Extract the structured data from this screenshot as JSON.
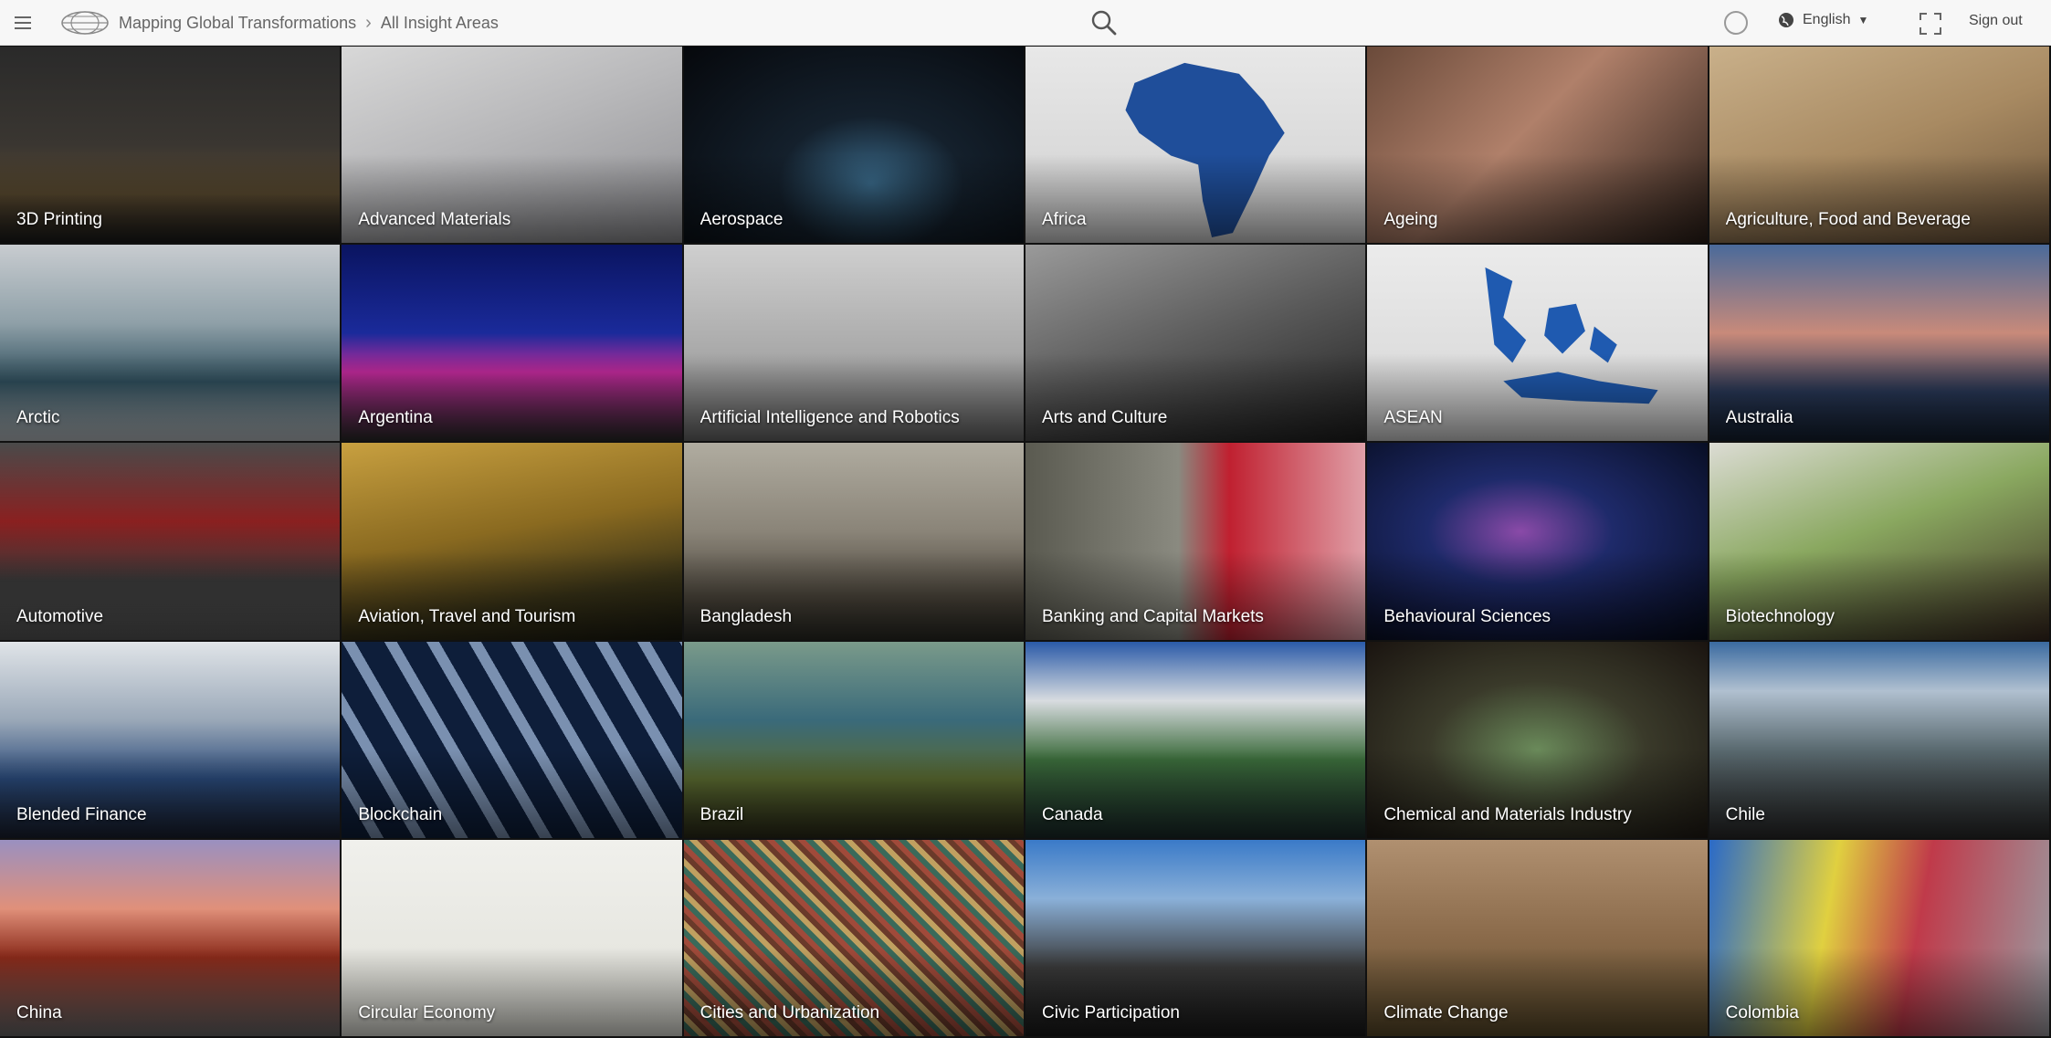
{
  "header": {
    "breadcrumb_root": "Mapping Global Transformations",
    "breadcrumb_separator": "›",
    "breadcrumb_current": "All Insight Areas",
    "language": "English",
    "sign_out": "Sign out"
  },
  "tiles": [
    {
      "label": "3D Printing",
      "bg": "linear-gradient(180deg,#2a2a2a 0%,#3a3631 50%,#5a4a30 75%,#1a1a1a 100%)"
    },
    {
      "label": "Advanced Materials",
      "bg": "linear-gradient(160deg,#d8d8d8 0%,#b8b8ba 45%,#8c8c90 100%)"
    },
    {
      "label": "Aerospace",
      "bg": "radial-gradient(ellipse at 55% 70%,#3a6a8a 0%,#14202c 35%,#06080c 100%)"
    },
    {
      "label": "Africa",
      "bg": "linear-gradient(180deg,#e8e8e8 0%,#cfcfcf 100%)"
    },
    {
      "label": "Ageing",
      "bg": "linear-gradient(135deg,#6a4a3a 0%,#b0806a 45%,#2a1e18 100%)"
    },
    {
      "label": "Agriculture, Food and Beverage",
      "bg": "linear-gradient(160deg,#c9b08a 0%,#a88a62 50%,#6a5238 100%)"
    },
    {
      "label": "Arctic",
      "bg": "linear-gradient(180deg,#c8ccd0 0%,#8fa0a8 40%,#30505e 70%,#c0c6ca 100%)"
    },
    {
      "label": "Argentina",
      "bg": "linear-gradient(180deg,#0a1460 0%,#1a2a9a 45%,#c02a9a 65%,#2a2a2a 100%)"
    },
    {
      "label": "Artificial Intelligence and Robotics",
      "bg": "linear-gradient(180deg,#cfcfcf 0%,#a6a6a6 60%,#6a6a6a 100%)"
    },
    {
      "label": "Arts and Culture",
      "bg": "linear-gradient(160deg,#9a9a9a 0%,#5a5a5a 50%,#1e1e1e 100%)"
    },
    {
      "label": "ASEAN",
      "bg": "linear-gradient(180deg,#ebebeb 0%,#d4d4d4 100%)"
    },
    {
      "label": "Australia",
      "bg": "linear-gradient(180deg,#4a6a9a 0%,#c88a7a 45%,#2a3a5a 75%,#142030 100%)"
    },
    {
      "label": "Automotive",
      "bg": "linear-gradient(180deg,#4a4a4a 0%,#8a2020 40%,#3a3a3a 70%,#5a5a5a 100%)"
    },
    {
      "label": "Aviation, Travel and Tourism",
      "bg": "linear-gradient(170deg,#c8a040 0%,#8a6a20 45%,#3a3418 75%,#1a1a10 100%)"
    },
    {
      "label": "Bangladesh",
      "bg": "linear-gradient(180deg,#b0aca0 0%,#8a8478 45%,#4a443a 80%,#2a2a24 100%)"
    },
    {
      "label": "Banking and Capital Markets",
      "bg": "linear-gradient(90deg,#5a5a50 0%,#8a8a80 45%,#c02030 60%,#e0a0a8 100%)"
    },
    {
      "label": "Behavioural Sciences",
      "bg": "radial-gradient(ellipse at 45% 45%,#8a4aa8 0%,#1e2a6a 35%,#050a1a 100%)"
    },
    {
      "label": "Biotechnology",
      "bg": "linear-gradient(160deg,#dcdcd4 0%,#8aa860 45%,#3a2a20 100%)"
    },
    {
      "label": "Blended Finance",
      "bg": "linear-gradient(180deg,#e0e4e8 0%,#9aa8b8 40%,#2a4a7a 70%,#1a2030 100%)"
    },
    {
      "label": "Blockchain",
      "bg": "repeating-linear-gradient(60deg,#0e1e3a 0px,#0e1e3a 28px,#7a90b0 28px,#7a90b0 40px)"
    },
    {
      "label": "Brazil",
      "bg": "linear-gradient(180deg,#7a9a8a 0%,#3a6a7a 40%,#5a6a30 70%,#2a2a18 100%)"
    },
    {
      "label": "Canada",
      "bg": "linear-gradient(180deg,#2a5aa8 0%,#d8dce0 30%,#3a6a3a 60%,#1a2a2a 100%)"
    },
    {
      "label": "Chemical and Materials Industry",
      "bg": "radial-gradient(ellipse at 50% 55%,#6a8a5a 0%,#3a3a2a 45%,#1a1410 100%)"
    },
    {
      "label": "Chile",
      "bg": "linear-gradient(180deg,#3a6aa0 0%,#b0c0d0 25%,#5a6a70 55%,#2a2a2a 100%)"
    },
    {
      "label": "China",
      "bg": "linear-gradient(180deg,#9a90c0 0%,#e0907a 35%,#8a2a1a 60%,#6a6a6a 100%)"
    },
    {
      "label": "Circular Economy",
      "bg": "linear-gradient(180deg,#f0f0ec 0%,#e0e0d8 100%)"
    },
    {
      "label": "Cities and Urbanization",
      "bg": "repeating-linear-gradient(45deg,#a04a3a 0px,#a04a3a 6px,#3a6a5a 6px,#3a6a5a 12px,#c0a060 12px,#c0a060 18px,#6a3a2a 18px,#6a3a2a 24px)"
    },
    {
      "label": "Civic Participation",
      "bg": "linear-gradient(180deg,#3a7ac8 0%,#8ab0d8 30%,#3a3a3a 65%,#1a1a1a 100%)"
    },
    {
      "label": "Climate Change",
      "bg": "linear-gradient(180deg,#b09070 0%,#8a6a4a 50%,#5a4a2a 100%)"
    },
    {
      "label": "Colombia",
      "bg": "linear-gradient(100deg,#2a6ac8 0%,#e0d040 35%,#c03a4a 60%,#9a9aa0 100%)"
    }
  ]
}
